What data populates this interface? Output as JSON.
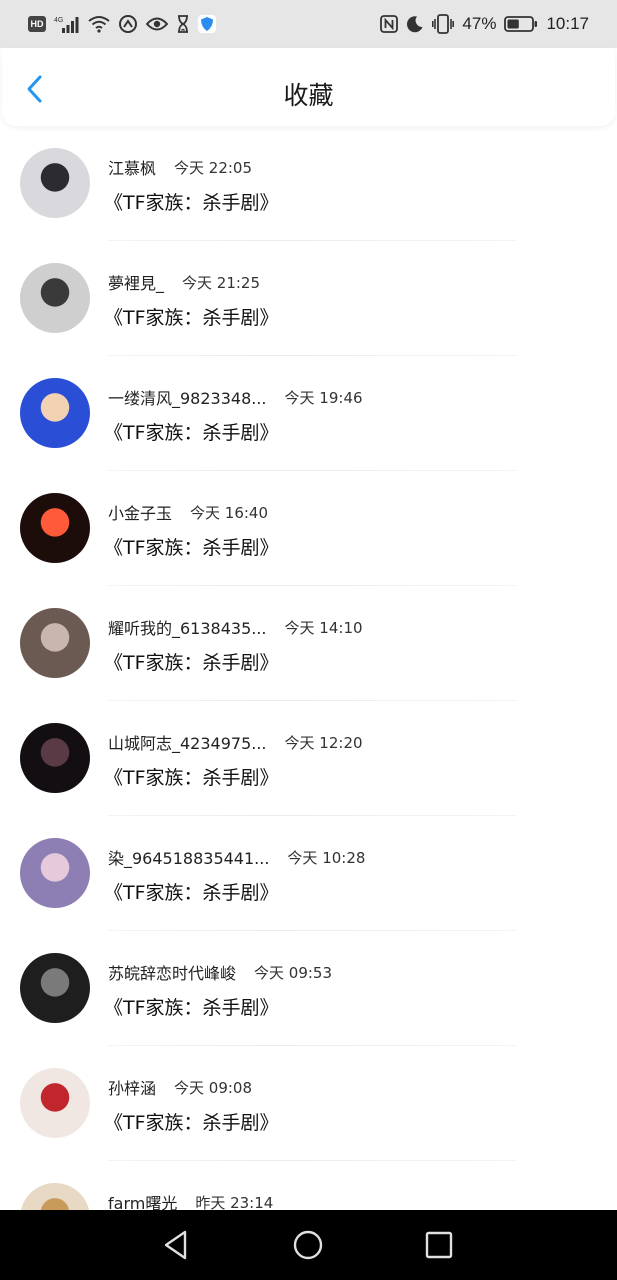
{
  "status_bar": {
    "left_icons": [
      "hd-icon",
      "signal-4g-icon",
      "wifi-icon",
      "speed-icon",
      "eye-icon",
      "hourglass-icon",
      "shield-app-icon"
    ],
    "network_label": "4G",
    "hd_label": "HD",
    "right_icons": [
      "nfc-icon",
      "moon-icon",
      "vibrate-icon",
      "battery-icon"
    ],
    "battery_text": "47%",
    "battery_level": 0.47,
    "time": "10:17"
  },
  "header": {
    "back_icon": "chevron-left-icon",
    "title": "收藏",
    "accent": "#2196f3"
  },
  "favorites": [
    {
      "name": "江慕枫",
      "time": "今天 22:05",
      "content": "《TF家族：杀手剧》",
      "avatar_colors": [
        "#d9d9dd",
        "#2b2b30"
      ]
    },
    {
      "name": "夢裡見_",
      "time": "今天 21:25",
      "content": "《TF家族：杀手剧》",
      "avatar_colors": [
        "#cfcfcf",
        "#3a3a3a"
      ]
    },
    {
      "name": "一缕清风_9823348...",
      "time": "今天 19:46",
      "content": "《TF家族：杀手剧》",
      "avatar_colors": [
        "#2a4fd6",
        "#f3d2b3"
      ]
    },
    {
      "name": "小金子玉",
      "time": "今天 16:40",
      "content": "《TF家族：杀手剧》",
      "avatar_colors": [
        "#1c0c0a",
        "#ff5a3a"
      ]
    },
    {
      "name": "耀听我的_6138435...",
      "time": "今天 14:10",
      "content": "《TF家族：杀手剧》",
      "avatar_colors": [
        "#6b5a52",
        "#c9b7ae"
      ]
    },
    {
      "name": "山城阿志_4234975...",
      "time": "今天 12:20",
      "content": "《TF家族：杀手剧》",
      "avatar_colors": [
        "#120e12",
        "#5a3a44"
      ]
    },
    {
      "name": "染_964518835441...",
      "time": "今天 10:28",
      "content": "《TF家族：杀手剧》",
      "avatar_colors": [
        "#8d7fb3",
        "#e7c9dc"
      ]
    },
    {
      "name": "苏皖辞恋时代峰峻",
      "time": "今天 09:53",
      "content": "《TF家族：杀手剧》",
      "avatar_colors": [
        "#1e1e1e",
        "#7a7a7a"
      ]
    },
    {
      "name": "孙梓涵",
      "time": "今天 09:08",
      "content": "《TF家族：杀手剧》",
      "avatar_colors": [
        "#f1e7e2",
        "#c0262c"
      ]
    },
    {
      "name": "farm曙光",
      "time": "昨天 23:14",
      "content": "",
      "avatar_colors": [
        "#e8d9c4",
        "#c99b5a"
      ]
    }
  ],
  "nav_bar": {
    "icons": [
      "back-triangle-icon",
      "home-circle-icon",
      "recents-square-icon"
    ]
  }
}
